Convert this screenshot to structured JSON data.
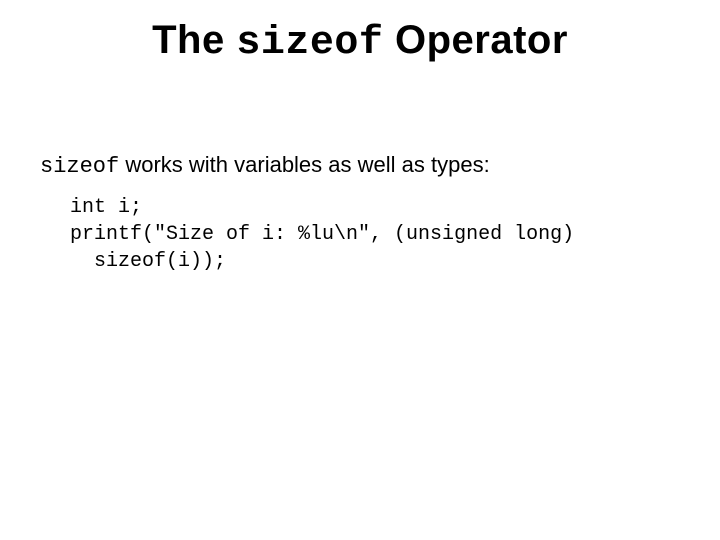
{
  "title": {
    "pre": "The ",
    "code": "sizeof",
    "post": " Operator"
  },
  "intro": {
    "code": "sizeof",
    "rest": " works with variables as well as types:"
  },
  "code": {
    "line1": "int i;",
    "line2": "printf(\"Size of i: %lu\\n\", (unsigned long)",
    "line3": "  sizeof(i));"
  }
}
